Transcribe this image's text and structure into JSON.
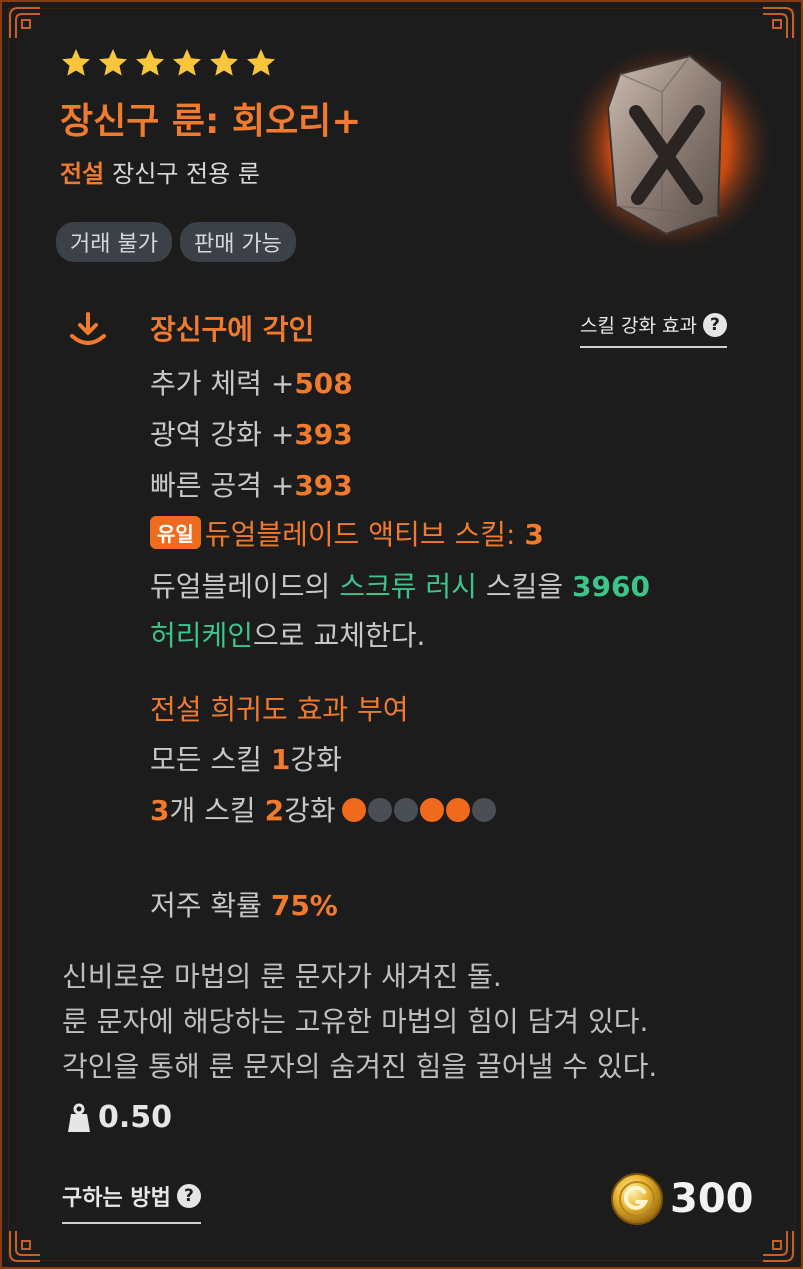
{
  "item": {
    "stars": 6,
    "name": "장신구 룬: 회오리+",
    "grade": "전설",
    "type": "장신구 전용 룬",
    "tags": [
      "거래 불가",
      "판매 가능"
    ]
  },
  "engrave": {
    "title": "장신구에 각인",
    "skill_link": "스킬 강화 효과",
    "skill_link_help": "?",
    "stats": [
      {
        "label": "추가 체력 +",
        "value": "508"
      },
      {
        "label": "광역 강화 +",
        "value": "393"
      },
      {
        "label": "빠른 공격 +",
        "value": "393"
      }
    ],
    "unique_badge": "유일",
    "unique_label": "듀얼블레이드 액티브 스킬: ",
    "unique_value": "3",
    "replace_prefix": "듀얼블레이드의 ",
    "replace_skill": "스크류 러시",
    "replace_mid": " 스킬을 ",
    "replace_num": "3960",
    "replace_new_skill": "허리케인",
    "replace_suffix": "으로 교체한다."
  },
  "rarity": {
    "title": "전설 희귀도 효과 부여",
    "all_prefix": "모든 스킬 ",
    "all_num": "1",
    "all_suffix": "강화",
    "three_num": "3",
    "three_mid": "개 스킬 ",
    "three_num2": "2",
    "three_suffix": "강화",
    "dots": [
      true,
      false,
      false,
      true,
      true,
      false
    ]
  },
  "curse": {
    "label": "저주 확률 ",
    "value": "75%"
  },
  "description": [
    "신비로운 마법의 룬 문자가 새겨진 돌.",
    "룬 문자에 해당하는 고유한 마법의 힘이 담겨 있다.",
    "각인을 통해 룬 문자의 숨겨진 힘을 끌어낼 수 있다."
  ],
  "weight": "0.50",
  "footer": {
    "how_to_get": "구하는 방법",
    "help": "?",
    "price": "300"
  },
  "colors": {
    "accent": "#f07a2e",
    "green": "#3cc48a",
    "star": "#f8c63a",
    "background": "#1c1c1c"
  }
}
